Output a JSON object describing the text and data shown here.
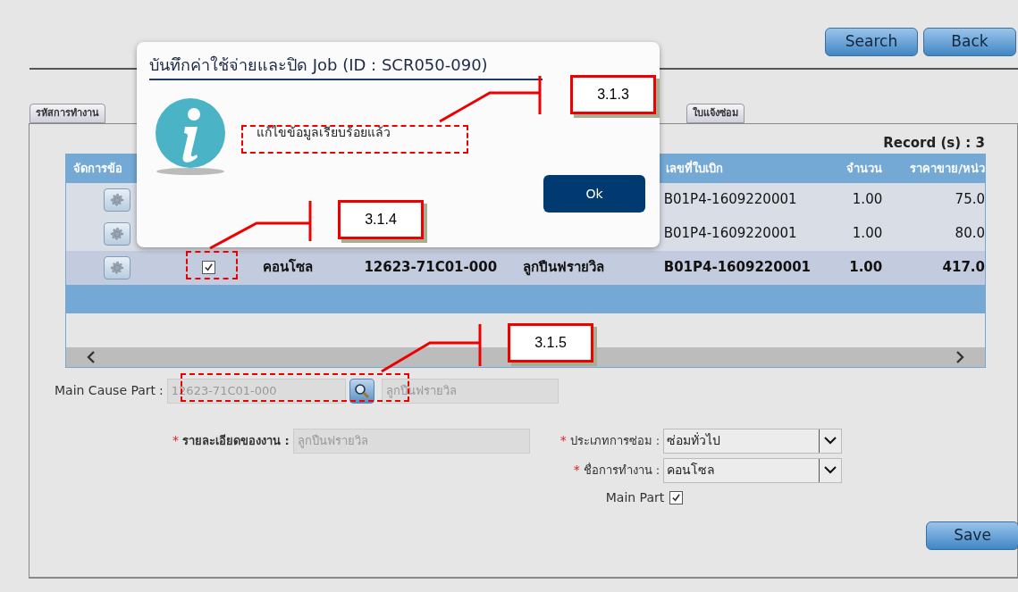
{
  "top_buttons": [
    "Search",
    "Back"
  ],
  "tabs": [
    {
      "label": "รหัสการทำงาน",
      "selected": false
    },
    {
      "label": "ใบแจ้งซ่อม",
      "selected": false
    }
  ],
  "record_count": "Record (s) : 3",
  "table": {
    "columns": [
      "จัดการข้อ",
      "เลขที่ใบเบิก",
      "จำนวน",
      "ราคาขาย/หน่ว"
    ],
    "rows": [
      {
        "selected": false,
        "requisition": "B01P4-1609220001",
        "qty": "1.00",
        "price": "75.0"
      },
      {
        "selected": false,
        "requisition": "B01P4-1609220001",
        "qty": "1.00",
        "price": "80.0"
      },
      {
        "selected": true,
        "checked": true,
        "part_name": "คอนโซล",
        "part_no": "12623-71C01-000",
        "description": "ลูกปืนฟรายวิล",
        "requisition": "B01P4-1609220001",
        "qty": "1.00",
        "price": "417.0"
      }
    ]
  },
  "main_cause_part": {
    "label": "Main Cause Part",
    "colon": ":",
    "value": "12623-71C01-000",
    "name_value": "ลูกปืนฟรายวิล"
  },
  "job_detail": {
    "required_mark": "*",
    "label": "รายละเอียดของงาน :",
    "value": "ลูกปืนฟรายวิล"
  },
  "repair_type": {
    "required_mark": "*",
    "label": "ประเภทการซ่อม :",
    "value": "ซ่อมทั่วไป"
  },
  "job_name": {
    "required_mark": "*",
    "label": "ชื่อการทำงาน :",
    "value": "คอนโซล"
  },
  "main_part": {
    "label": "Main Part",
    "checked": true
  },
  "save_button": "Save",
  "dialog": {
    "title": "บันทึกค่าใช้จ่ายและปิด Job (ID : SCR050-090)",
    "message": "แก้ไขข้อมูลเรียบร้อยแล้ว",
    "ok": "Ok"
  },
  "callouts": [
    {
      "label": "3.1.3"
    },
    {
      "label": "3.1.4"
    },
    {
      "label": "3.1.5"
    }
  ]
}
